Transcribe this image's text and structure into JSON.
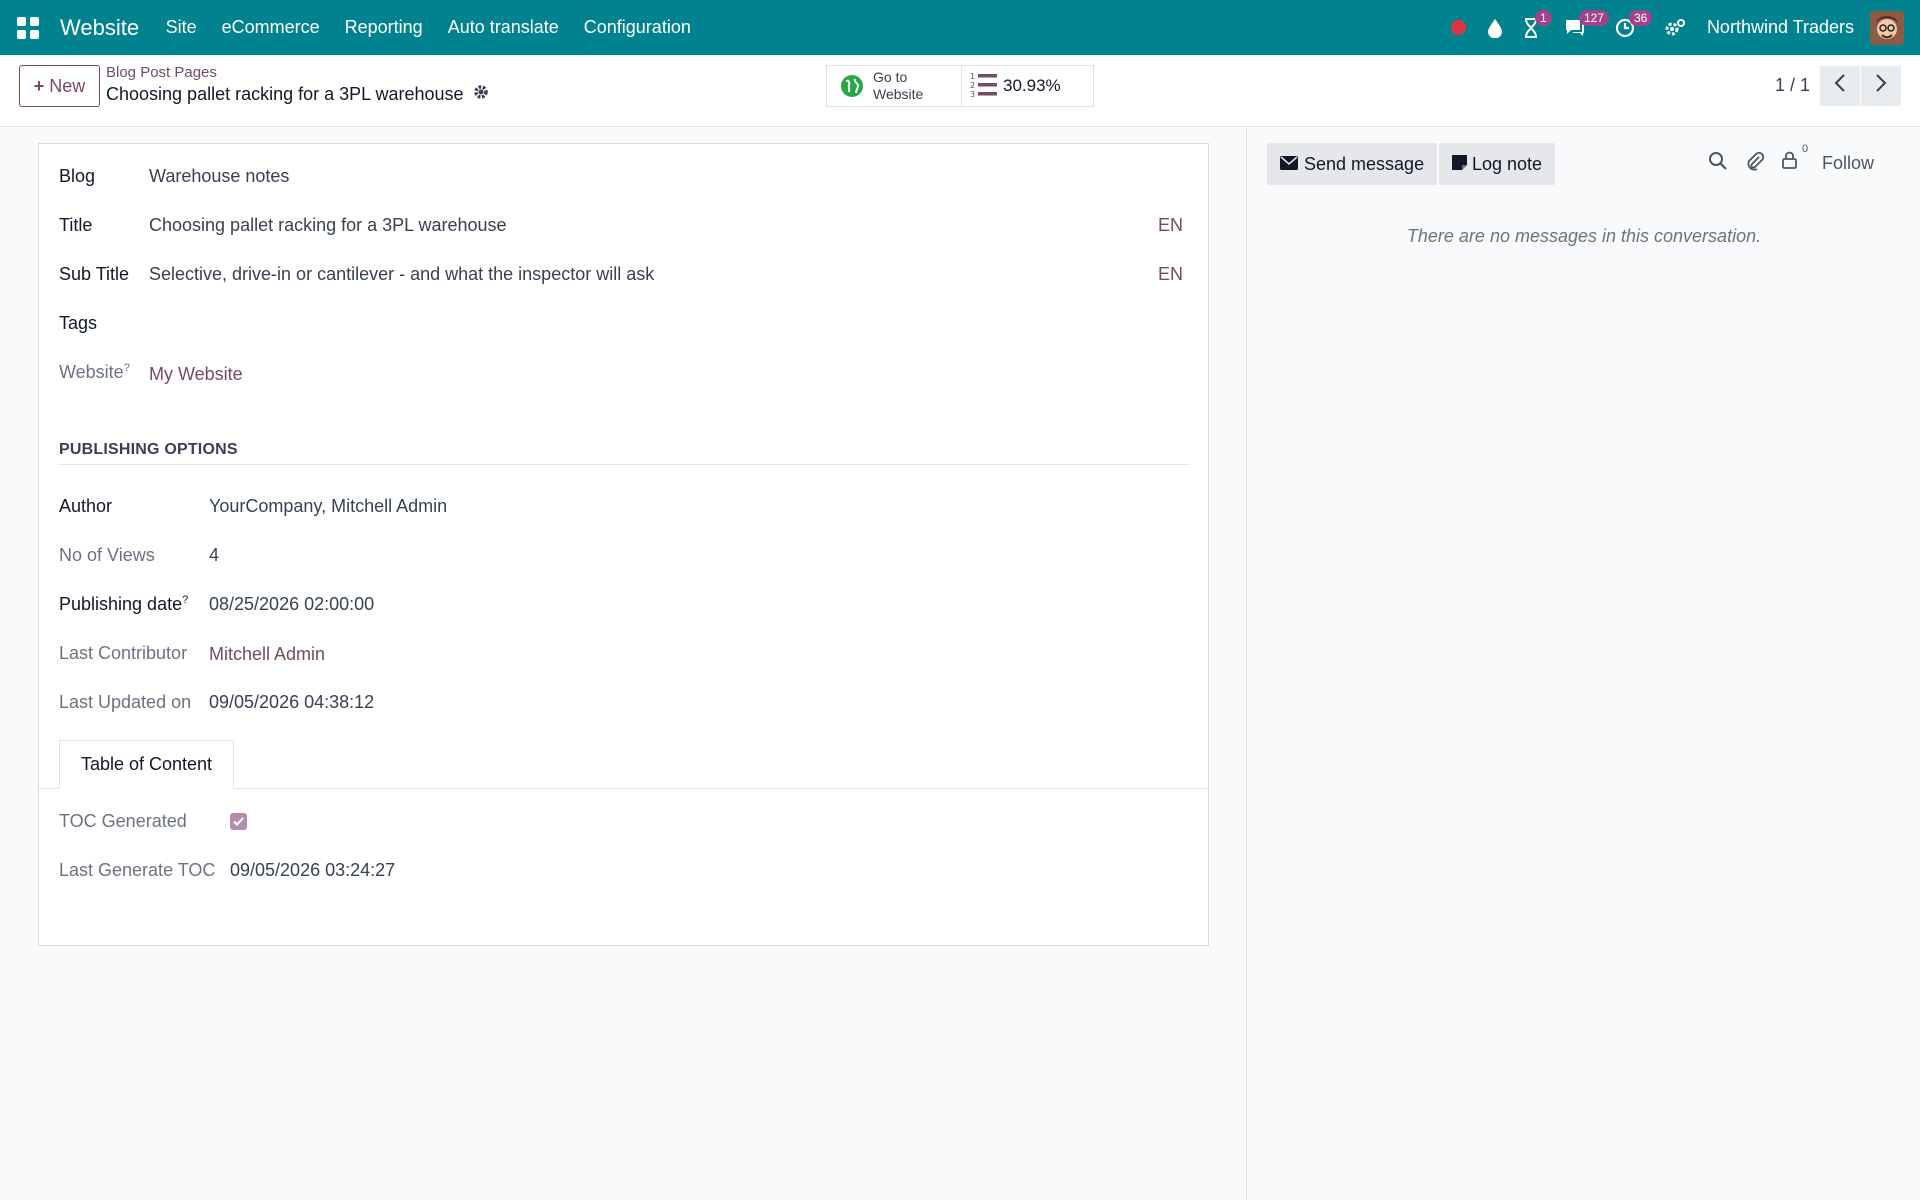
{
  "navbar": {
    "brand": "Website",
    "menus": [
      "Site",
      "eCommerce",
      "Reporting",
      "Auto translate",
      "Configuration"
    ],
    "activity_badge": "1",
    "messages_badge": "127",
    "clock_badge": "36",
    "company": "Northwind Traders"
  },
  "control": {
    "new_label": "New",
    "breadcrumb_parent": "Blog Post Pages",
    "breadcrumb_current": "Choosing pallet racking for a 3PL warehouse",
    "go_to_line1": "Go to",
    "go_to_line2": "Website",
    "seo_score": "30.93%",
    "pager": "1 / 1"
  },
  "form": {
    "blog_label": "Blog",
    "blog_value": "Warehouse notes",
    "title_label": "Title",
    "title_value": "Choosing pallet racking for a 3PL warehouse",
    "subtitle_label": "Sub Title",
    "subtitle_value": "Selective, drive-in or cantilever - and what the inspector will ask",
    "lang": "EN",
    "tags_label": "Tags",
    "website_label": "Website",
    "website_value": "My Website",
    "help_mark": "?",
    "section_title": "PUBLISHING OPTIONS",
    "author_label": "Author",
    "author_value": "YourCompany, Mitchell Admin",
    "views_label": "No of Views",
    "views_value": "4",
    "pubdate_label": "Publishing date",
    "pubdate_value": "08/25/2026 02:00:00",
    "contrib_label": "Last Contributor",
    "contrib_value": "Mitchell Admin",
    "updated_label": "Last Updated on",
    "updated_value": "09/05/2026 04:38:12",
    "tab_label": "Table of Content",
    "toc_label": "TOC Generated",
    "toc_checked": true,
    "lasttoc_label": "Last Generate TOC",
    "lasttoc_value": "09/05/2026 03:24:27"
  },
  "chatter": {
    "send_label": "Send message",
    "log_label": "Log note",
    "followers_count": "0",
    "follow_label": "Follow",
    "empty_text": "There are no messages in this conversation."
  },
  "colors": {
    "navbar": "#01838f",
    "accent": "#714b67"
  }
}
